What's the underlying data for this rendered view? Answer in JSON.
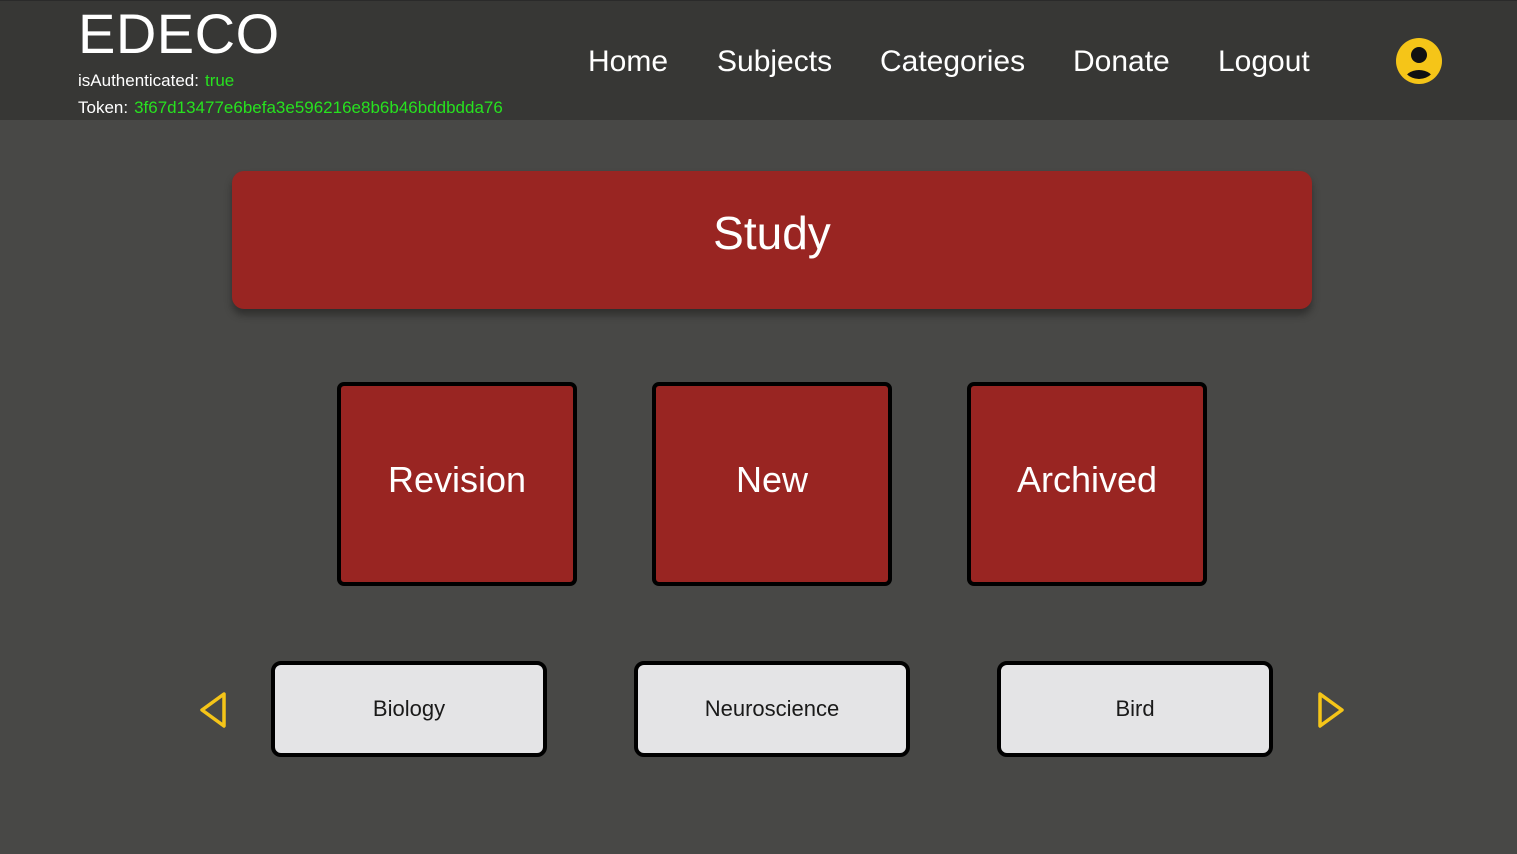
{
  "header": {
    "brand": "EDECO",
    "auth": {
      "authenticated_label": "isAuthenticated:",
      "authenticated_value": "true",
      "token_label": "Token:",
      "token_value": "3f67d13477e6befa3e596216e8b6b46bddbdda76"
    },
    "nav": {
      "home": "Home",
      "subjects": "Subjects",
      "categories": "Categories",
      "donate": "Donate",
      "logout": "Logout"
    },
    "avatar_icon": "user-circle-icon"
  },
  "main": {
    "study_title": "Study",
    "modes": {
      "revision": "Revision",
      "new": "New",
      "archived": "Archived"
    },
    "subjects": [
      "Biology",
      "Neuroscience",
      "Bird"
    ],
    "carousel": {
      "prev_icon": "triangle-left-icon",
      "next_icon": "triangle-right-icon"
    }
  },
  "colors": {
    "page_bg": "#484846",
    "header_bg": "#373735",
    "accent_red": "#992522",
    "status_green": "#27e21f",
    "icon_yellow": "#f5c518",
    "card_light": "#e4e4e6"
  }
}
